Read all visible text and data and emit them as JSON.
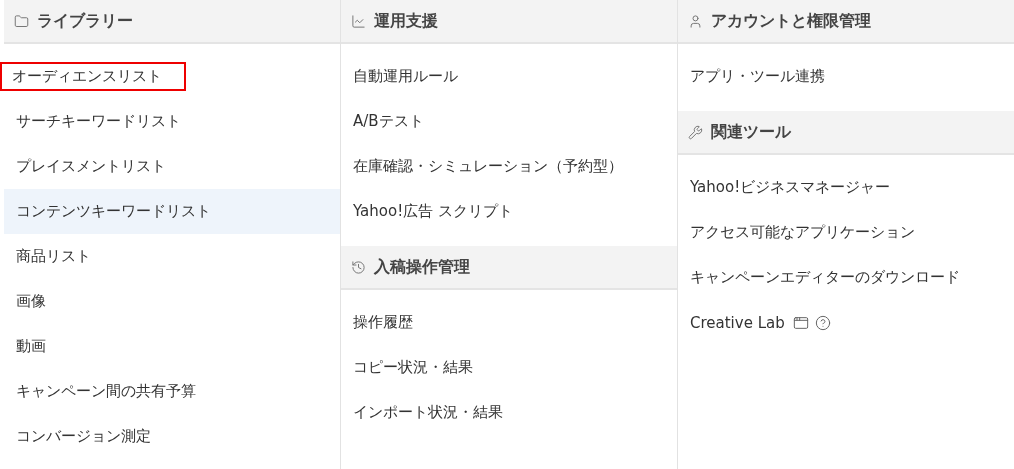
{
  "columns": [
    {
      "sections": [
        {
          "title": "ライブラリー",
          "kind": "folder",
          "items": [
            {
              "label": "オーディエンスリスト",
              "outlined": true,
              "highlighted": false
            },
            {
              "label": "サーチキーワードリスト",
              "outlined": false,
              "highlighted": false
            },
            {
              "label": "プレイスメントリスト",
              "outlined": false,
              "highlighted": false
            },
            {
              "label": "コンテンツキーワードリスト",
              "outlined": false,
              "highlighted": true
            },
            {
              "label": "商品リスト",
              "outlined": false,
              "highlighted": false
            },
            {
              "label": "画像",
              "outlined": false,
              "highlighted": false
            },
            {
              "label": "動画",
              "outlined": false,
              "highlighted": false
            },
            {
              "label": "キャンペーン間の共有予算",
              "outlined": false,
              "highlighted": false
            },
            {
              "label": "コンバージョン測定",
              "outlined": false,
              "highlighted": false
            }
          ]
        }
      ]
    },
    {
      "sections": [
        {
          "title": "運用支援",
          "kind": "chart",
          "items": [
            {
              "label": "自動運用ルール",
              "outlined": false,
              "highlighted": false
            },
            {
              "label": "A/Bテスト",
              "outlined": false,
              "highlighted": false
            },
            {
              "label": "在庫確認・シミュレーション（予約型）",
              "outlined": false,
              "highlighted": false
            },
            {
              "label": "Yahoo!広告 スクリプト",
              "outlined": false,
              "highlighted": false
            }
          ]
        },
        {
          "title": "入稿操作管理",
          "kind": "history",
          "items": [
            {
              "label": "操作履歴",
              "outlined": false,
              "highlighted": false
            },
            {
              "label": "コピー状況・結果",
              "outlined": false,
              "highlighted": false
            },
            {
              "label": "インポート状況・結果",
              "outlined": false,
              "highlighted": false
            }
          ]
        }
      ]
    },
    {
      "sections": [
        {
          "title": "アカウントと権限管理",
          "kind": "user",
          "items": [
            {
              "label": "アプリ・ツール連携",
              "outlined": false,
              "highlighted": false
            }
          ]
        },
        {
          "title": "関連ツール",
          "kind": "wrench",
          "items": [
            {
              "label": "Yahoo!ビジネスマネージャー",
              "outlined": false,
              "highlighted": false
            },
            {
              "label": "アクセス可能なアプリケーション",
              "outlined": false,
              "highlighted": false
            },
            {
              "label": "キャンペーンエディターのダウンロード",
              "outlined": false,
              "highlighted": false
            },
            {
              "label": "Creative Lab",
              "outlined": false,
              "highlighted": false,
              "kind": "external-help"
            }
          ]
        }
      ]
    }
  ]
}
